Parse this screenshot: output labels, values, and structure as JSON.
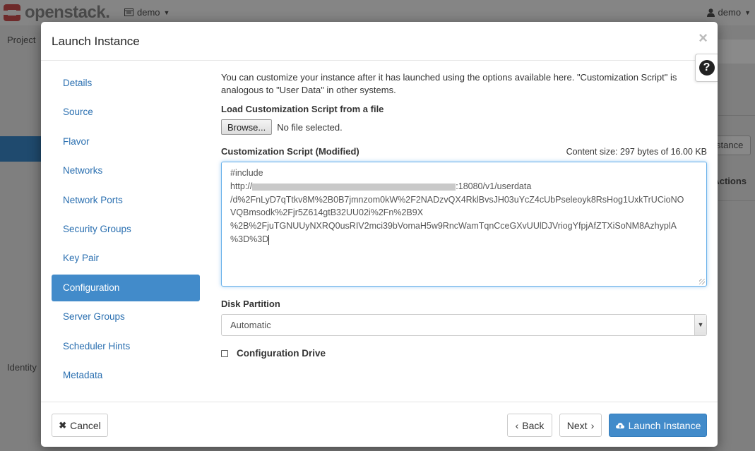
{
  "app": {
    "logo_text": "openstack.",
    "project_selector": "demo",
    "user_menu": "demo"
  },
  "background": {
    "sidebar_items": [
      "Project",
      "Identity"
    ],
    "instance_button_fragment": "stance",
    "actions_header_fragment": "Actions"
  },
  "modal": {
    "title": "Launch Instance",
    "help_symbol": "?",
    "close_symbol": "×",
    "nav": [
      {
        "label": "Details",
        "active": false
      },
      {
        "label": "Source",
        "active": false
      },
      {
        "label": "Flavor",
        "active": false
      },
      {
        "label": "Networks",
        "active": false
      },
      {
        "label": "Network Ports",
        "active": false
      },
      {
        "label": "Security Groups",
        "active": false
      },
      {
        "label": "Key Pair",
        "active": false
      },
      {
        "label": "Configuration",
        "active": true
      },
      {
        "label": "Server Groups",
        "active": false
      },
      {
        "label": "Scheduler Hints",
        "active": false
      },
      {
        "label": "Metadata",
        "active": false
      }
    ],
    "config": {
      "intro": "You can customize your instance after it has launched using the options available here. \"Customization Script\" is analogous to \"User Data\" in other systems.",
      "load_label": "Load Customization Script from a file",
      "browse_label": "Browse...",
      "file_status": "No file selected.",
      "script_label": "Customization Script (Modified)",
      "content_size": "Content size: 297 bytes of 16.00 KB",
      "script_lines": {
        "line1": "#include",
        "line2_prefix": "http://",
        "line2_suffix": ":18080/v1/userdata",
        "line3": "/d%2FnLyD7qTtkv8M%2B0B7jmnzom0kW%2F2NADzvQX4RklBvsJH03uYcZ4cUbPseleoyk8RsHog1UxkTrUCioNO",
        "line4": "VQBmsodk%2Fjr5Z614gtB32UU02i%2Fn%2B9X",
        "line5": "%2B%2FjuTGNUUyNXRQ0usRIV2mci39bVomaH5w9RncWamTqnCceGXvUUlDJVriogYfpjAfZTXiSoNM8AzhyplA",
        "line6": "%3D%3D"
      },
      "disk_label": "Disk Partition",
      "disk_value": "Automatic",
      "config_drive_label": "Configuration Drive",
      "config_drive_checked": false
    },
    "footer": {
      "cancel": "Cancel",
      "back": "Back",
      "next": "Next",
      "launch": "Launch Instance"
    }
  },
  "colors": {
    "primary": "#428bca",
    "link": "#2a6fb0",
    "logo_red": "#da1a32"
  }
}
